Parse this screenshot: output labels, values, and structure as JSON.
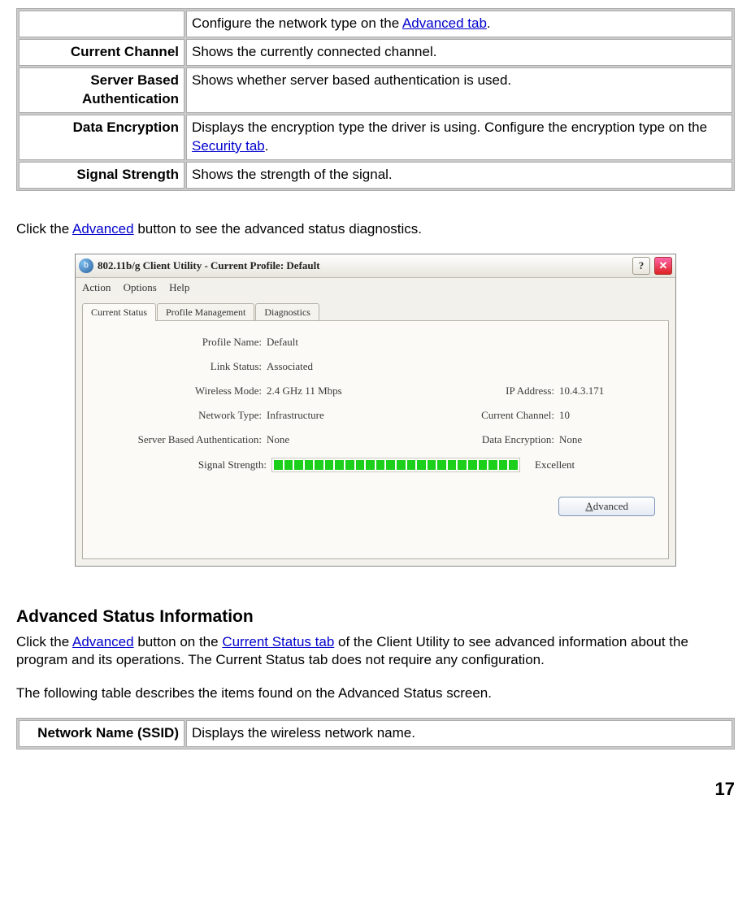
{
  "table1": {
    "row0": {
      "label": "",
      "descPre": "Configure the network type on the ",
      "link": "Advanced tab",
      "descPost": "."
    },
    "row1": {
      "label": "Current Channel",
      "desc": "Shows the currently connected channel."
    },
    "row2": {
      "label": "Server Based Authentication",
      "desc": "Shows whether server based authentication is used."
    },
    "row3": {
      "label": "Data Encryption",
      "descPre": "Displays the encryption type the driver is using.    Configure the encryption type on the ",
      "link": "Security tab",
      "descPost": "."
    },
    "row4": {
      "label": "Signal Strength",
      "desc": "Shows the strength of the signal."
    }
  },
  "para1": {
    "pre": "Click the ",
    "link": "Advanced",
    "post": " button to see the advanced status diagnostics."
  },
  "screenshot": {
    "title": "802.11b/g Client Utility - Current Profile: Default",
    "menu": {
      "action": "Action",
      "options": "Options",
      "help": "Help"
    },
    "tabs": {
      "current": "Current Status",
      "profile": "Profile Management",
      "diag": "Diagnostics"
    },
    "fields": {
      "profileName": {
        "label": "Profile Name:",
        "value": "Default"
      },
      "linkStatus": {
        "label": "Link Status:",
        "value": "Associated"
      },
      "wirelessMode": {
        "label": "Wireless Mode:",
        "value": "2.4 GHz 11 Mbps"
      },
      "ip": {
        "label": "IP Address:",
        "value": "10.4.3.171"
      },
      "networkType": {
        "label": "Network Type:",
        "value": "Infrastructure"
      },
      "channel": {
        "label": "Current Channel:",
        "value": "10"
      },
      "auth": {
        "label": "Server Based Authentication:",
        "value": "None"
      },
      "enc": {
        "label": "Data Encryption:",
        "value": "None"
      },
      "signal": {
        "label": "Signal Strength:",
        "text": "Excellent"
      }
    },
    "advancedBtn": "Advanced"
  },
  "section2": {
    "heading": "Advanced Status Information",
    "para": {
      "t1": "Click the ",
      "l1": "Advanced",
      "t2": " button on the ",
      "l2": "Current Status tab",
      "t3": " of the Client Utility to see advanced information about the program and its operations. The Current Status tab does not require any configuration."
    },
    "para2": "The following table describes the items found on the Advanced Status screen."
  },
  "table2": {
    "row0": {
      "label": "Network Name (SSID)",
      "desc": "Displays the wireless network name."
    }
  },
  "pageNumber": "17"
}
